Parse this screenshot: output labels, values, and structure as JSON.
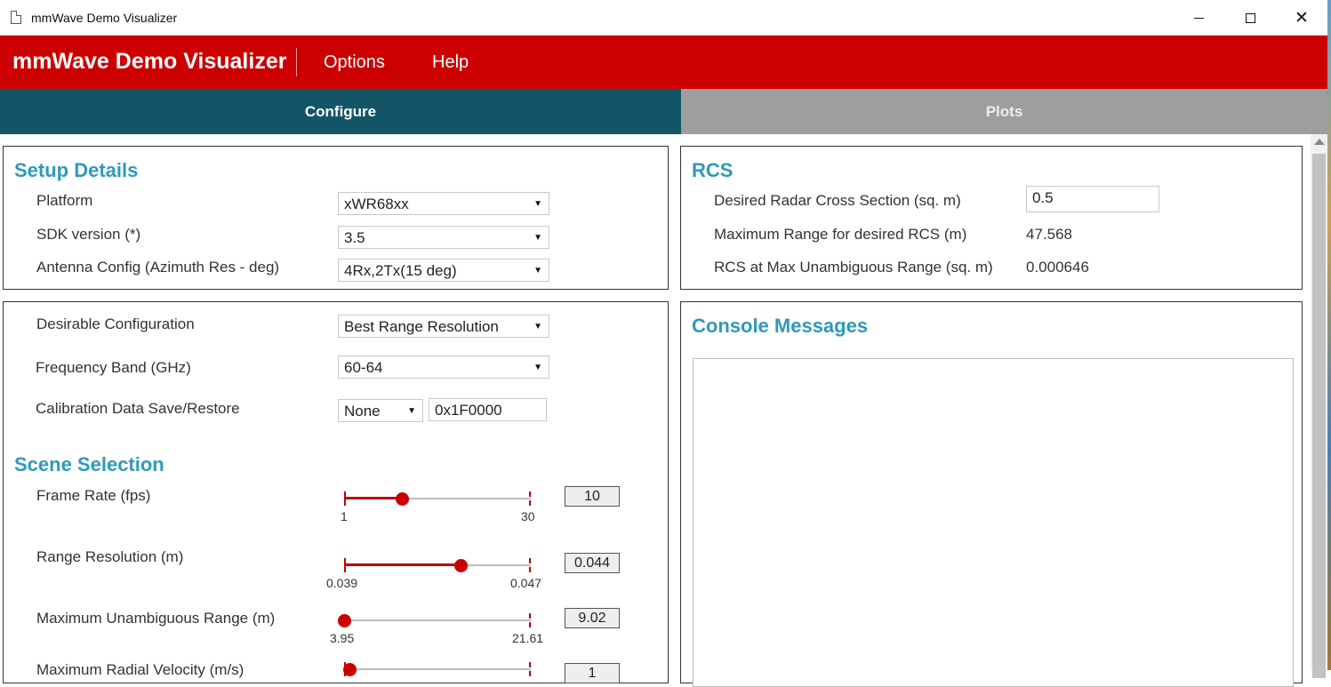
{
  "window": {
    "title": "mmWave Demo Visualizer"
  },
  "appbar": {
    "brand": "mmWave Demo Visualizer",
    "menu": [
      "Options",
      "Help"
    ]
  },
  "tabs": [
    {
      "label": "Configure",
      "active": true
    },
    {
      "label": "Plots",
      "active": false
    }
  ],
  "setup": {
    "heading": "Setup Details",
    "platform_label": "Platform",
    "platform_value": "xWR68xx",
    "sdk_label": "SDK version (*)",
    "sdk_value": "3.5",
    "antenna_label": "Antenna Config (Azimuth Res - deg)",
    "antenna_value": "4Rx,2Tx(15 deg)"
  },
  "rcs": {
    "heading": "RCS",
    "desired_label": "Desired Radar Cross Section (sq. m)",
    "desired_value": "0.5",
    "maxrange_label": "Maximum Range for desired RCS (m)",
    "maxrange_value": "47.568",
    "rcsmax_label": "RCS at Max Unambiguous Range (sq. m)",
    "rcsmax_value": "0.000646"
  },
  "config": {
    "desirable_label": "Desirable Configuration",
    "desirable_value": "Best Range Resolution",
    "freq_label": "Frequency Band (GHz)",
    "freq_value": "60-64",
    "calib_label": "Calibration Data Save/Restore",
    "calib_value": "None",
    "calib_addr": "0x1F0000"
  },
  "scene": {
    "heading": "Scene Selection",
    "sliders": [
      {
        "label": "Frame Rate (fps)",
        "min": "1",
        "max": "30",
        "value": "10",
        "fraction": 0.31
      },
      {
        "label": "Range Resolution (m)",
        "min": "0.039",
        "max": "0.047",
        "value": "0.044",
        "fraction": 0.625
      },
      {
        "label": "Maximum Unambiguous Range (m)",
        "min": "3.95",
        "max": "21.61",
        "value": "9.02",
        "fraction": 0.0
      },
      {
        "label": "Maximum Radial Velocity (m/s)",
        "value": "1",
        "fraction": 0.03
      }
    ]
  },
  "console": {
    "heading": "Console Messages"
  },
  "colors": {
    "appbar": "#cc0000",
    "tab_active": "#135567",
    "tab_inactive": "#9e9e9e",
    "heading": "#2f9ab8",
    "slider": "#c00000"
  }
}
